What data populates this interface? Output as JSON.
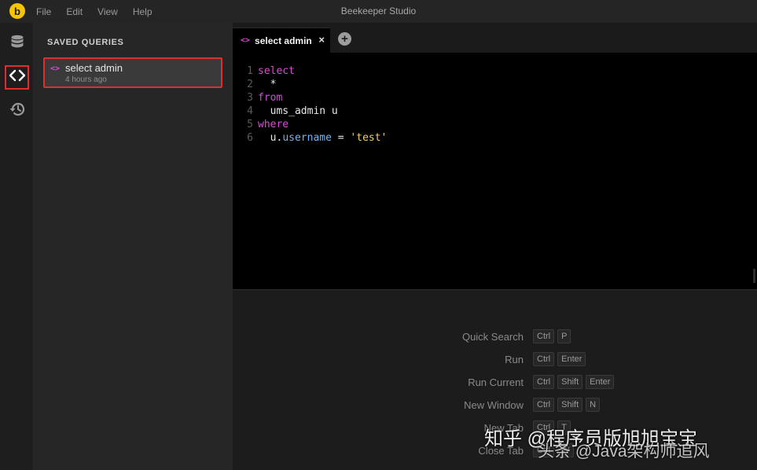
{
  "window": {
    "title": "Beekeeper Studio",
    "logo_glyph": "b",
    "logo_color": "#f5c500"
  },
  "menu": [
    "File",
    "Edit",
    "View",
    "Help"
  ],
  "rail": {
    "items": [
      {
        "name": "database-icon",
        "active": false
      },
      {
        "name": "code-icon",
        "active": true
      },
      {
        "name": "history-icon",
        "active": false
      }
    ]
  },
  "sidebar": {
    "heading": "SAVED QUERIES",
    "queries": [
      {
        "icon": "<>",
        "title": "select admin",
        "time": "4 hours ago"
      }
    ]
  },
  "tabs": [
    {
      "icon": "<>",
      "label": "select admin",
      "close": "×"
    }
  ],
  "new_tab_glyph": "+",
  "editor": {
    "lines": [
      {
        "num": "1",
        "tokens": [
          {
            "t": "select",
            "c": "kw"
          }
        ]
      },
      {
        "num": "2",
        "tokens": [
          {
            "t": "  *",
            "c": ""
          }
        ]
      },
      {
        "num": "3",
        "tokens": [
          {
            "t": "from",
            "c": "kw"
          }
        ]
      },
      {
        "num": "4",
        "tokens": [
          {
            "t": "  ums_admin u",
            "c": ""
          }
        ]
      },
      {
        "num": "5",
        "tokens": [
          {
            "t": "where",
            "c": "kw"
          }
        ]
      },
      {
        "num": "6",
        "tokens": [
          {
            "t": "  u.",
            "c": ""
          },
          {
            "t": "username",
            "c": "prop"
          },
          {
            "t": " = ",
            "c": ""
          },
          {
            "t": "'test'",
            "c": "str"
          }
        ]
      }
    ]
  },
  "shortcuts": [
    {
      "label": "Quick Search",
      "keys": [
        "Ctrl",
        "P"
      ]
    },
    {
      "label": "Run",
      "keys": [
        "Ctrl",
        "Enter"
      ]
    },
    {
      "label": "Run Current",
      "keys": [
        "Ctrl",
        "Shift",
        "Enter"
      ]
    },
    {
      "label": "New Window",
      "keys": [
        "Ctrl",
        "Shift",
        "N"
      ]
    },
    {
      "label": "New Tab",
      "keys": [
        "Ctrl",
        "T"
      ]
    },
    {
      "label": "Close Tab",
      "keys": [
        "Ctrl",
        "W"
      ]
    }
  ],
  "watermark": {
    "line1": "知乎 @程序员版旭旭宝宝",
    "line2": "头条 @Java架构师追风"
  },
  "colors": {
    "keyword": "#d84fd6",
    "property": "#7ab3ee",
    "string": "#f1cf6b",
    "highlight_border": "#d93030"
  }
}
